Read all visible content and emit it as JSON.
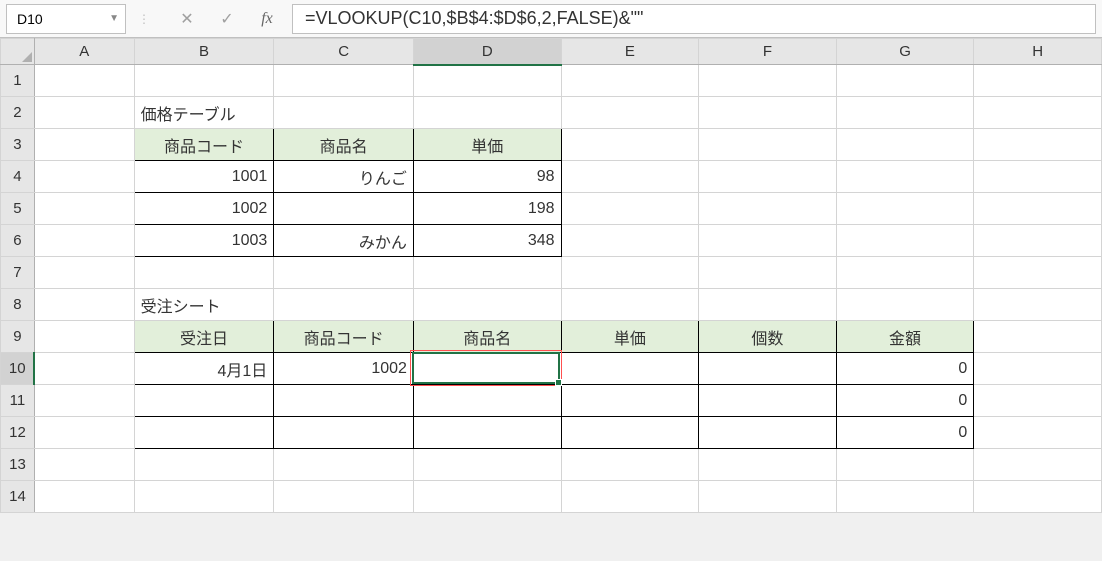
{
  "name_box": "D10",
  "formula_input": "=VLOOKUP(C10,$B$4:$D$6,2,FALSE)&\"\"",
  "columns": [
    "A",
    "B",
    "C",
    "D",
    "E",
    "F",
    "G",
    "H"
  ],
  "rows": [
    "1",
    "2",
    "3",
    "4",
    "5",
    "6",
    "7",
    "8",
    "9",
    "10",
    "11",
    "12",
    "13",
    "14"
  ],
  "selected_col": "D",
  "selected_row": "10",
  "titles": {
    "price_table": "価格テーブル",
    "order_sheet": "受注シート"
  },
  "price_table": {
    "headers": [
      "商品コード",
      "商品名",
      "単価"
    ],
    "rows": [
      {
        "code": "1001",
        "name": "りんご",
        "price": "98"
      },
      {
        "code": "1002",
        "name": "",
        "price": "198"
      },
      {
        "code": "1003",
        "name": "みかん",
        "price": "348"
      }
    ]
  },
  "order_sheet": {
    "headers": [
      "受注日",
      "商品コード",
      "商品名",
      "単価",
      "個数",
      "金額"
    ],
    "rows": [
      {
        "date": "4月1日",
        "code": "1002",
        "name": "",
        "price": "",
        "qty": "",
        "amount": "0"
      },
      {
        "date": "",
        "code": "",
        "name": "",
        "price": "",
        "qty": "",
        "amount": "0"
      },
      {
        "date": "",
        "code": "",
        "name": "",
        "price": "",
        "qty": "",
        "amount": "0"
      }
    ]
  },
  "chart_data": {
    "type": "table",
    "tables": [
      {
        "title": "価格テーブル",
        "headers": [
          "商品コード",
          "商品名",
          "単価"
        ],
        "rows": [
          [
            "1001",
            "りんご",
            98
          ],
          [
            "1002",
            "",
            198
          ],
          [
            "1003",
            "みかん",
            348
          ]
        ]
      },
      {
        "title": "受注シート",
        "headers": [
          "受注日",
          "商品コード",
          "商品名",
          "単価",
          "個数",
          "金額"
        ],
        "rows": [
          [
            "4月1日",
            "1002",
            "",
            "",
            "",
            0
          ],
          [
            "",
            "",
            "",
            "",
            "",
            0
          ],
          [
            "",
            "",
            "",
            "",
            "",
            0
          ]
        ]
      }
    ]
  }
}
